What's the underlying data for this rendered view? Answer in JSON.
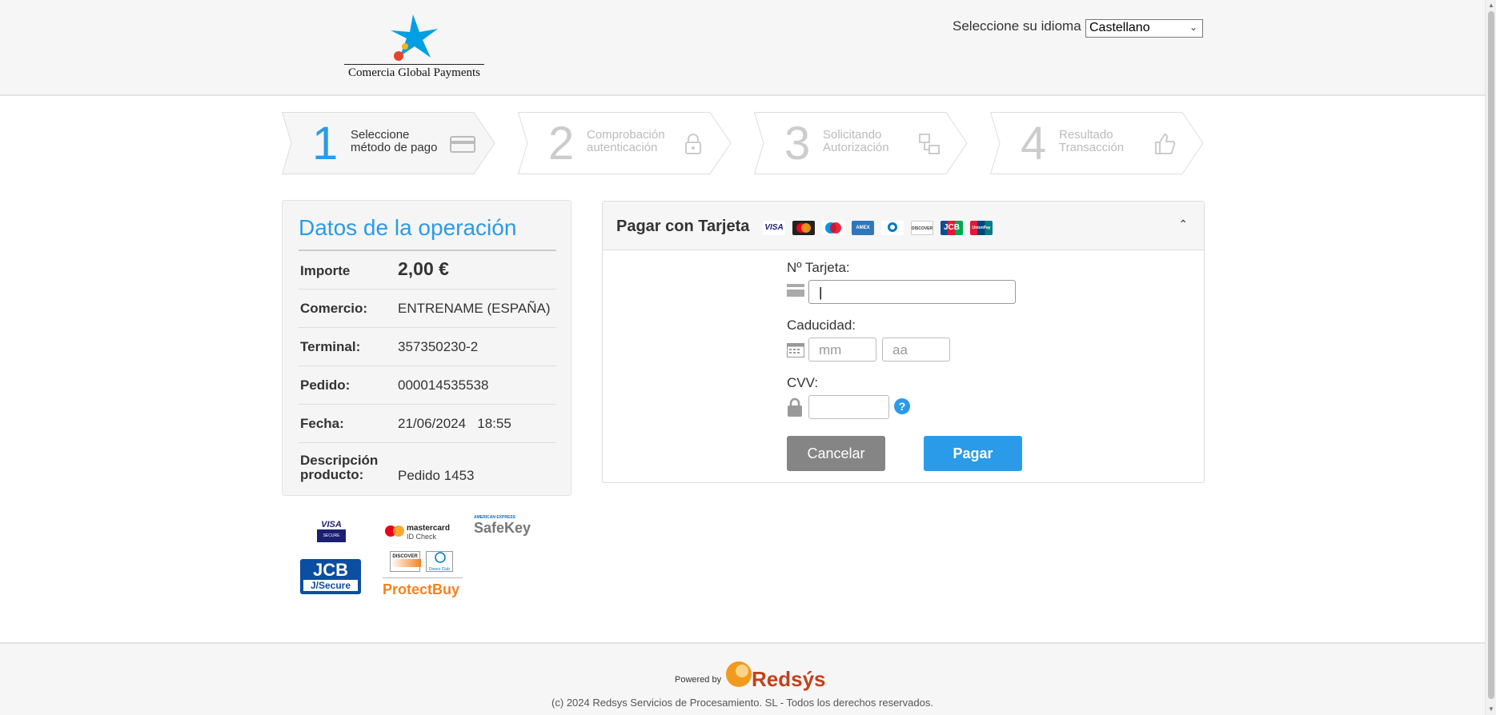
{
  "header": {
    "logo_text": "Comercia Global Payments",
    "language_label": "Seleccione su idioma",
    "language_selected": "Castellano"
  },
  "steps": [
    {
      "number": "1",
      "line1": "Seleccione",
      "line2": "método de pago",
      "icon": "credit-card-icon",
      "active": true
    },
    {
      "number": "2",
      "line1": "Comprobación",
      "line2": "autenticación",
      "icon": "lock-icon",
      "active": false
    },
    {
      "number": "3",
      "line1": "Solicitando",
      "line2": "Autorización",
      "icon": "transfer-icon",
      "active": false
    },
    {
      "number": "4",
      "line1": "Resultado",
      "line2": "Transacción",
      "icon": "thumbs-up-icon",
      "active": false
    }
  ],
  "operation": {
    "title": "Datos de la operación",
    "rows": [
      {
        "label": "Importe",
        "value": "2,00 €"
      },
      {
        "label": "Comercio:",
        "value": "ENTRENAME (ESPAÑA)"
      },
      {
        "label": "Terminal:",
        "value": "357350230-2"
      },
      {
        "label": "Pedido:",
        "value": "000014535538"
      },
      {
        "label": "Fecha:",
        "value": "21/06/2024   18:55"
      },
      {
        "label": "Descripción producto:",
        "label_line1": "Descripción",
        "label_line2": "producto:",
        "value": "Pedido 1453"
      }
    ]
  },
  "security_brands": {
    "visa_secure": "VISA",
    "visa_secure_sub": "SECURE",
    "mastercard_id": "mastercard",
    "mastercard_id_sub": "ID Check",
    "amex_top": "AMERICAN EXPRESS",
    "amex_safekey": "SafeKey",
    "jcb": "JCB",
    "jcb_sub": "J/Secure",
    "discover": "DISCOVER",
    "diners": "Diners Club",
    "protectbuy": "ProtectBuy"
  },
  "payment": {
    "title": "Pagar con Tarjeta",
    "card_brands": [
      "VISA",
      "MC",
      "Maestro",
      "AMEX",
      "Diners",
      "DISCOVER",
      "JCB",
      "UnionPay"
    ],
    "card_number_label": "Nº Tarjeta:",
    "card_number_value": "",
    "expiry_label": "Caducidad:",
    "expiry_month_placeholder": "mm",
    "expiry_year_placeholder": "aa",
    "cvv_label": "CVV:",
    "cvv_value": "",
    "cancel_label": "Cancelar",
    "pay_label": "Pagar"
  },
  "footer": {
    "powered_by": "Powered by",
    "brand": "Redsýs",
    "copyright": "(c) 2024 Redsys Servicios de Procesamiento. SL - Todos los derechos reservados."
  },
  "colors": {
    "accent_blue": "#2a9be8",
    "cancel_gray": "#858585",
    "redsys_orange": "#f29a1e",
    "logo_blue": "#009fe3"
  }
}
